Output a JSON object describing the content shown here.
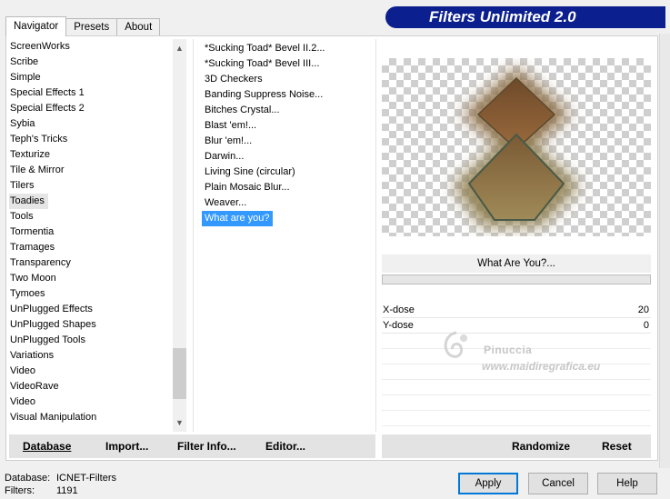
{
  "tabs": [
    "Navigator",
    "Presets",
    "About"
  ],
  "banner": {
    "title": "Filters Unlimited 2.0"
  },
  "categories": [
    "ScreenWorks",
    "Scribe",
    "Simple",
    "Special Effects 1",
    "Special Effects 2",
    "Sybia",
    "Teph's Tricks",
    "Texturize",
    "Tile & Mirror",
    "Tilers",
    "Toadies",
    "Tools",
    "Tormentia",
    "Tramages",
    "Transparency",
    "Two Moon",
    "Tymoes",
    "UnPlugged Effects",
    "UnPlugged Shapes",
    "UnPlugged Tools",
    "Variations",
    "Video",
    "VideoRave",
    "Video",
    "Visual Manipulation"
  ],
  "selected_category": "Toadies",
  "filters": [
    "*Sucking Toad*  Bevel II.2...",
    "*Sucking Toad*  Bevel III...",
    "3D Checkers",
    "Banding Suppress Noise...",
    "Bitches Crystal...",
    "Blast 'em!...",
    "Blur 'em!...",
    "Darwin...",
    "Living Sine (circular)",
    "Plain Mosaic Blur...",
    "Weaver...",
    "What are you?"
  ],
  "selected_filter": "What are you?",
  "filter_title": "What Are You?...",
  "params": [
    {
      "name": "X-dose",
      "value": "20"
    },
    {
      "name": "Y-dose",
      "value": "0"
    }
  ],
  "watermark": {
    "line1": "Pinuccia",
    "line2": "www.maidiregrafica.eu"
  },
  "left_buttons": {
    "database": "Database",
    "import": "Import...",
    "filter_info": "Filter Info...",
    "editor": "Editor..."
  },
  "right_buttons": {
    "randomize": "Randomize",
    "reset": "Reset"
  },
  "status": {
    "database_label": "Database:",
    "database_value": "ICNET-Filters",
    "filters_label": "Filters:",
    "filters_value": "1191"
  },
  "dialog": {
    "apply": "Apply",
    "cancel": "Cancel",
    "help": "Help"
  },
  "colors": {
    "banner": "#0b1f8e",
    "selection": "#3399ff",
    "default_button_border": "#0078d7"
  }
}
